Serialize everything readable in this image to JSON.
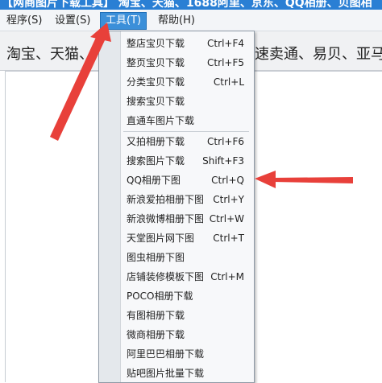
{
  "titlebar": {
    "title": "【网商图片下载工具】 淘宝、天猫、1688阿里、京东、QQ相册、贝图相"
  },
  "menubar": {
    "items": [
      {
        "label": "程序(S)",
        "active": false
      },
      {
        "label": "设置(S)",
        "active": false
      },
      {
        "label": "工具(T)",
        "active": true
      },
      {
        "label": "帮助(H)",
        "active": false
      }
    ]
  },
  "toolbar": {
    "left_text": "淘宝、天猫、",
    "right_text": "速卖通、易贝、亚马"
  },
  "dropdown": {
    "items": [
      {
        "label": "整店宝贝下载",
        "shortcut": "Ctrl+F4"
      },
      {
        "label": "整页宝贝下载",
        "shortcut": "Ctrl+F5"
      },
      {
        "label": "分类宝贝下载",
        "shortcut": "Ctrl+L"
      },
      {
        "label": "搜索宝贝下载",
        "shortcut": ""
      },
      {
        "label": "直通车图片下载",
        "shortcut": ""
      },
      {
        "label": "又拍相册下载",
        "shortcut": "Ctrl+F6"
      },
      {
        "label": "搜索图片下载",
        "shortcut": "Shift+F3"
      },
      {
        "label": "QQ相册下图",
        "shortcut": "Ctrl+Q"
      },
      {
        "label": "新浪爱拍相册下图",
        "shortcut": "Ctrl+Y"
      },
      {
        "label": "新浪微博相册下图",
        "shortcut": "Ctrl+W"
      },
      {
        "label": "天堂图片网下图",
        "shortcut": "Ctrl+T"
      },
      {
        "label": "图虫相册下图",
        "shortcut": ""
      },
      {
        "label": "店铺装修模板下图",
        "shortcut": "Ctrl+M"
      },
      {
        "label": "POCO相册下载",
        "shortcut": ""
      },
      {
        "label": "有图相册下载",
        "shortcut": ""
      },
      {
        "label": "微商相册下载",
        "shortcut": ""
      },
      {
        "label": "阿里巴巴相册下载",
        "shortcut": ""
      },
      {
        "label": "贴吧图片批量下载",
        "shortcut": ""
      }
    ]
  },
  "colors": {
    "titlebar": "#2a7fd4",
    "menu_active": "#3b8fd9",
    "arrow": "#e8403a"
  }
}
